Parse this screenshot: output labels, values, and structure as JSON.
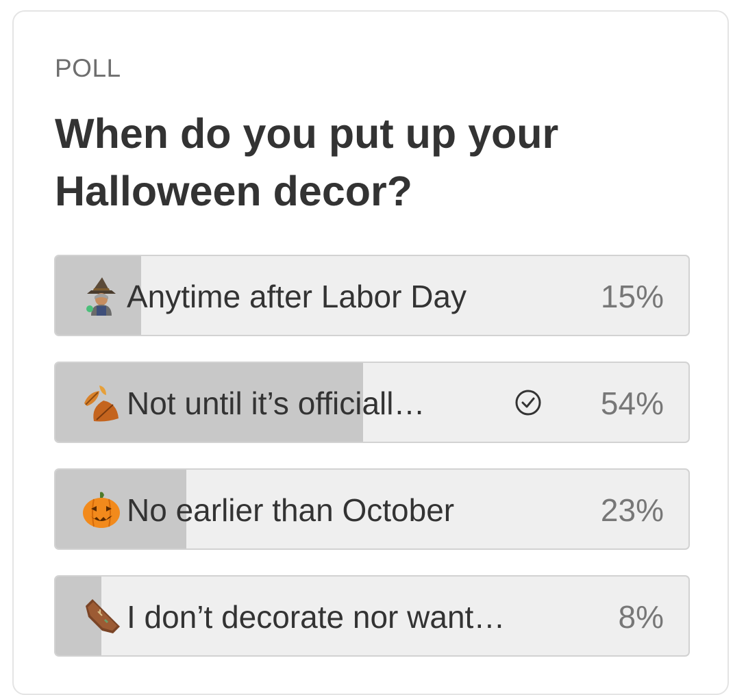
{
  "poll": {
    "label": "POLL",
    "question": "When do you put up your Halloween decor?",
    "options": [
      {
        "icon": "witch-icon",
        "label": "Anytime after Labor Day",
        "percent_text": "15%",
        "percent": 15,
        "selected": false
      },
      {
        "icon": "fallen-leaves-icon",
        "label": "Not until it’s officiall…",
        "percent_text": "54%",
        "percent": 54,
        "selected": true
      },
      {
        "icon": "jack-o-lantern-icon",
        "label": "No earlier than October",
        "percent_text": "23%",
        "percent": 23,
        "selected": false
      },
      {
        "icon": "coffin-icon",
        "label": "I don’t decorate nor want…",
        "percent_text": "8%",
        "percent": 8,
        "selected": false
      }
    ]
  },
  "colors": {
    "bar_fill": "#c8c8c8",
    "bar_track": "#efefef",
    "text": "#333333",
    "muted": "#777777"
  }
}
